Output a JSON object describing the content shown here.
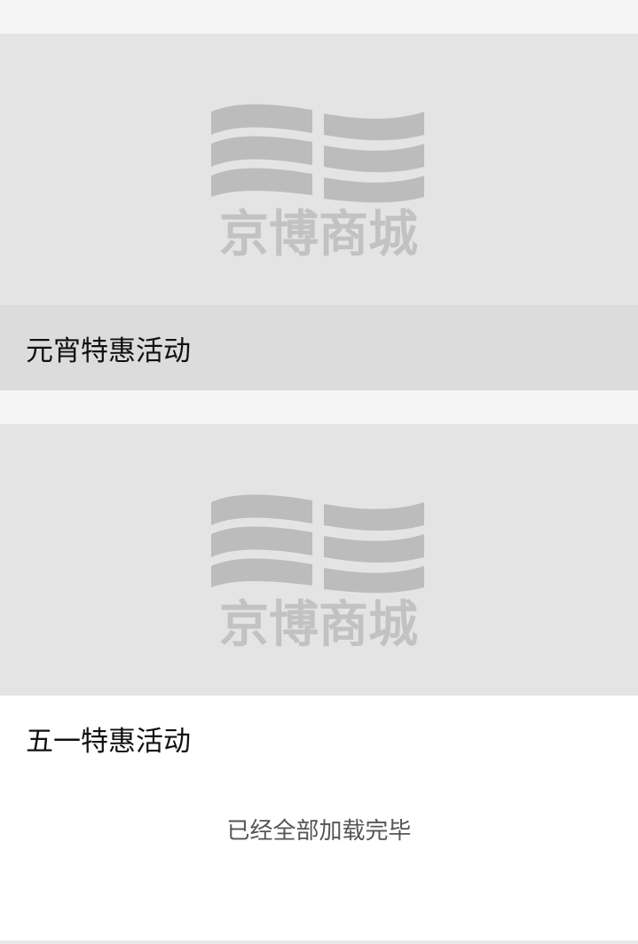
{
  "activities": [
    {
      "title": "元宵特惠活动",
      "image_logo_icon": "jingbo-logo-icon",
      "logo_text": "京博商城",
      "state": "pressed"
    },
    {
      "title": "五一特惠活动",
      "image_logo_icon": "jingbo-logo-icon",
      "logo_text": "京博商城",
      "state": "normal"
    }
  ],
  "footer": {
    "status_text": "已经全部加载完毕"
  },
  "colors": {
    "page_bg": "#f4f5f4",
    "image_bg": "#e4e4e4",
    "pressed_bg": "#dcdcdc",
    "logo_gray": "#b8b8b8"
  }
}
